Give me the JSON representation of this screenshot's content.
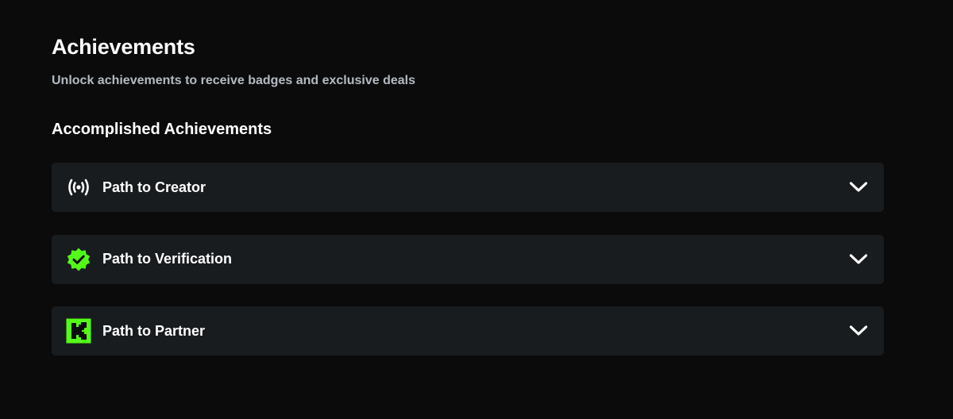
{
  "header": {
    "title": "Achievements",
    "subtitle": "Unlock achievements to receive badges and exclusive deals"
  },
  "section": {
    "title": "Accomplished Achievements"
  },
  "achievements": [
    {
      "label": "Path to Creator",
      "icon": "broadcast-icon",
      "icon_color": "#ffffff"
    },
    {
      "label": "Path to Verification",
      "icon": "verified-badge-icon",
      "icon_color": "#53fc18"
    },
    {
      "label": "Path to Partner",
      "icon": "kick-logo-icon",
      "icon_color": "#53fc18"
    }
  ],
  "colors": {
    "background": "#0b0b0c",
    "card": "#181c1f",
    "accent": "#53fc18",
    "subtitle": "#b4bac2"
  }
}
